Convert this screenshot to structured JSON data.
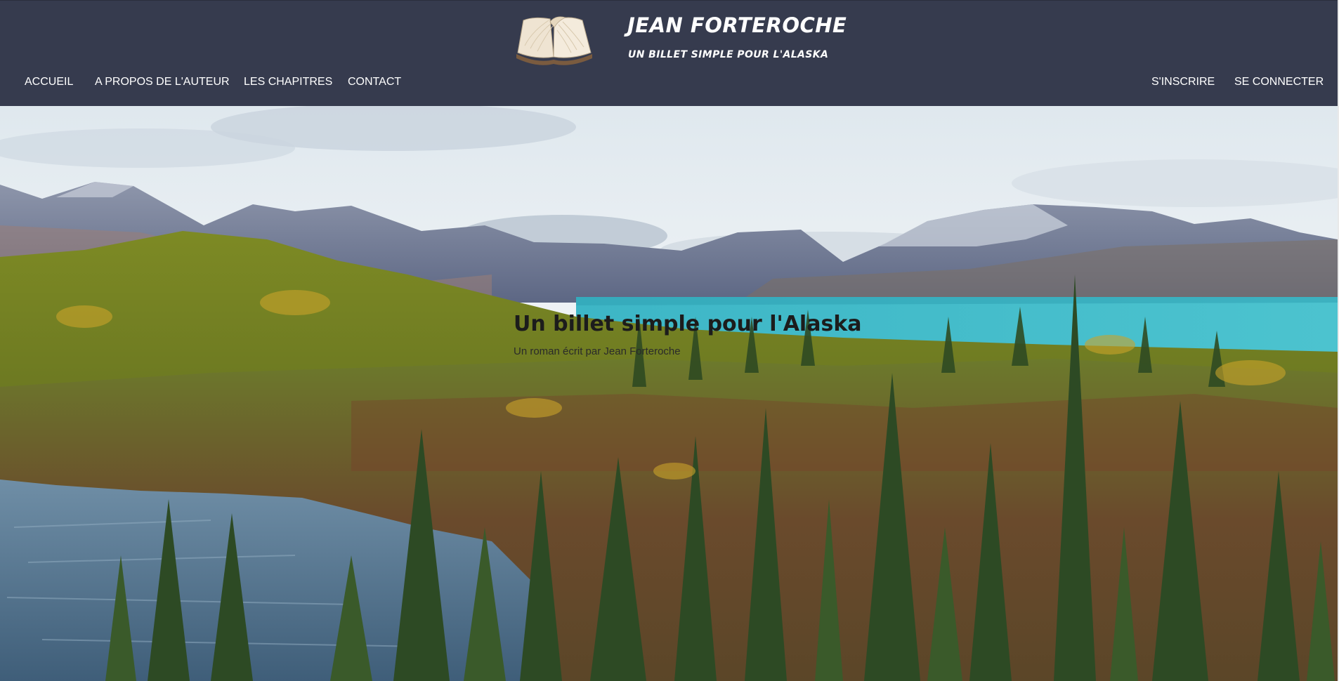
{
  "header": {
    "logo_icon": "open-book-icon",
    "title": "JEAN FORTEROCHE",
    "subtitle": "UN BILLET SIMPLE POUR L'ALASKA",
    "nav_left": [
      {
        "label": "ACCUEIL"
      },
      {
        "label": "A PROPOS DE L'AUTEUR"
      },
      {
        "label": "LES CHAPITRES"
      },
      {
        "label": "CONTACT"
      }
    ],
    "nav_right": [
      {
        "label": "S'INSCRIRE"
      },
      {
        "label": "SE CONNECTER"
      }
    ]
  },
  "hero": {
    "title": "Un billet simple pour l'Alaska",
    "subtitle": "Un roman écrit par Jean Forteroche"
  },
  "colors": {
    "header_bg": "#363b4e",
    "header_text": "#ffffff",
    "lake": "#3fb8c9"
  }
}
